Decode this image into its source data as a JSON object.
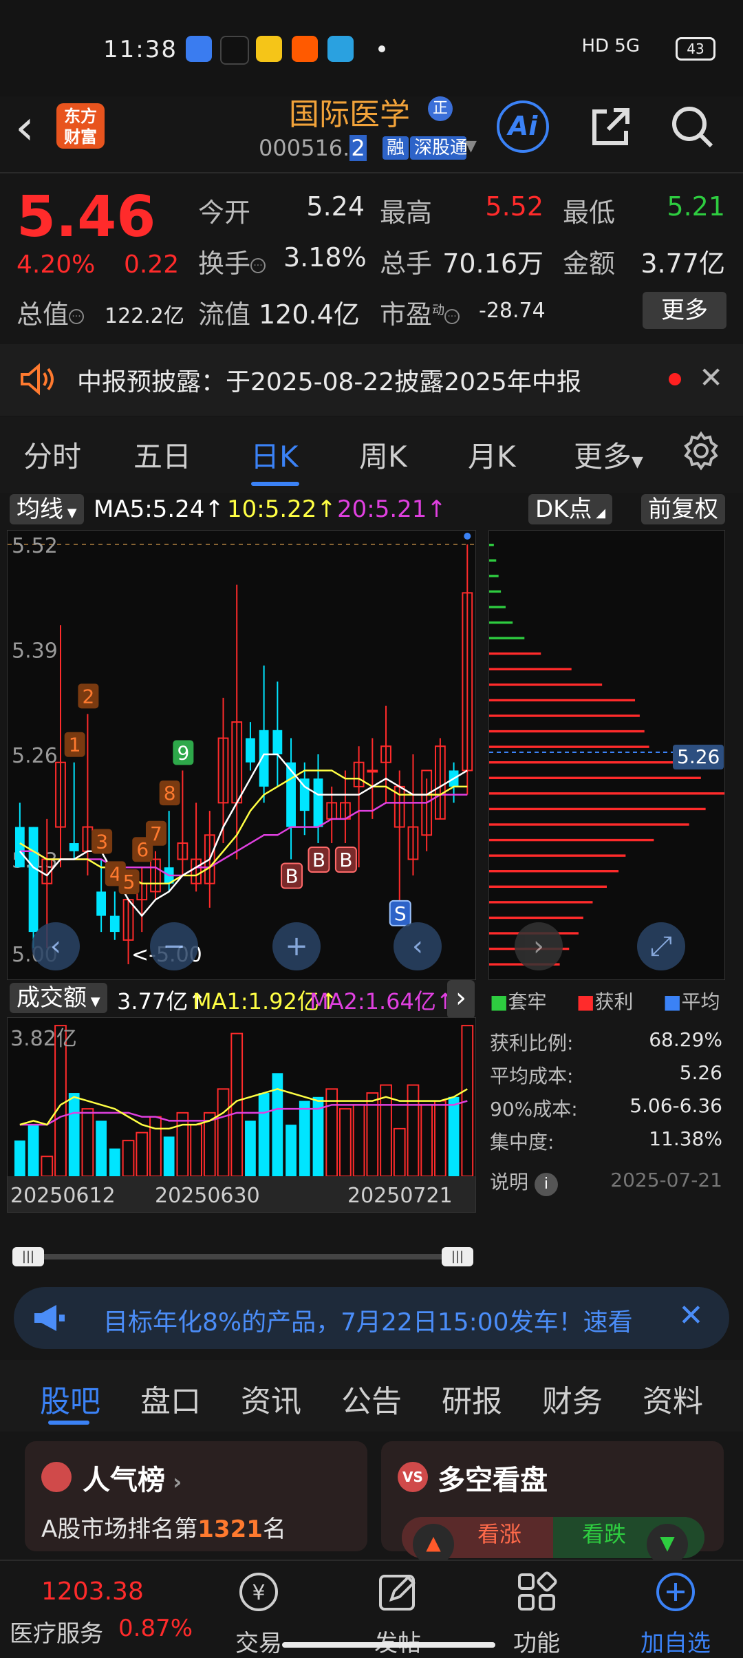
{
  "status_bar": {
    "time": "11:38",
    "network": "HD 5G",
    "battery": "43",
    "app_icons": [
      "app-icon-1",
      "tiktok-icon",
      "app-icon-3",
      "taobao-icon",
      "telegram-icon"
    ]
  },
  "header": {
    "stock_name": "国际医学",
    "name_badge": "正",
    "code": "000516.",
    "code_suffix": "2",
    "tags": [
      "融",
      "深股通"
    ],
    "logo_text_1": "东方",
    "logo_text_2": "财富",
    "ai_label": "Ai"
  },
  "quote": {
    "price": "5.46",
    "change_pct": "4.20%",
    "change": "0.22",
    "open_label": "今开",
    "open": "5.24",
    "high_label": "最高",
    "high": "5.52",
    "low_label": "最低",
    "low": "5.21",
    "turnover_label": "换手",
    "turnover": "3.18%",
    "volume_label": "总手",
    "volume": "70.16万",
    "amount_label": "金额",
    "amount": "3.77亿",
    "mktcap_label": "总值",
    "mktcap": "122.2亿",
    "float_label": "流值",
    "float": "120.4亿",
    "pe_label": "市盈",
    "pe_sup": "动",
    "pe": "-28.74",
    "more_label": "更多"
  },
  "notice": {
    "text": "中报预披露：于2025-08-22披露2025年中报"
  },
  "chart_tabs": [
    "分时",
    "五日",
    "日K",
    "周K",
    "月K",
    "更多"
  ],
  "chart_legend": {
    "ma_selector": "均线",
    "ma5": "MA5:5.24",
    "ma10": "10:5.22",
    "ma20": "20:5.21",
    "dk_label": "DK点",
    "adjust_label": "前复权",
    "arrow": "↑"
  },
  "colors": {
    "up": "#ff2b2b",
    "down": "#00e5ff",
    "ma5": "#ffffff",
    "ma10": "#ffff44",
    "ma20": "#e040e0",
    "accent": "#3b82f6",
    "green": "#2ecc40"
  },
  "chart_data": {
    "type": "candlestick",
    "y_ticks": [
      "5.52",
      "5.39",
      "5.26",
      "5.13",
      "5.00"
    ],
    "ylim": [
      5.0,
      5.52
    ],
    "high_marker": "5.52->",
    "low_marker": "<-5.00",
    "x_ticks": [
      "20250612",
      "20250630",
      "20250721"
    ],
    "candles": [
      {
        "o": 5.17,
        "h": 5.2,
        "l": 5.12,
        "c": 5.12
      },
      {
        "o": 5.17,
        "h": 5.17,
        "l": 5.02,
        "c": 5.04
      },
      {
        "o": 5.1,
        "h": 5.18,
        "l": 5.02,
        "c": 5.13
      },
      {
        "o": 5.17,
        "h": 5.42,
        "l": 5.12,
        "c": 5.25
      },
      {
        "o": 5.15,
        "h": 5.25,
        "l": 5.13,
        "c": 5.14
      },
      {
        "o": 5.14,
        "h": 5.31,
        "l": 5.11,
        "c": 5.17
      },
      {
        "o": 5.09,
        "h": 5.13,
        "l": 5.04,
        "c": 5.06
      },
      {
        "o": 5.06,
        "h": 5.09,
        "l": 5.03,
        "c": 5.04
      },
      {
        "o": 5.03,
        "h": 5.08,
        "l": 5.0,
        "c": 5.08
      },
      {
        "o": 5.08,
        "h": 5.12,
        "l": 5.04,
        "c": 5.1
      },
      {
        "o": 5.09,
        "h": 5.14,
        "l": 5.08,
        "c": 5.13
      },
      {
        "o": 5.12,
        "h": 5.19,
        "l": 5.09,
        "c": 5.1
      },
      {
        "o": 5.13,
        "h": 5.24,
        "l": 5.11,
        "c": 5.15
      },
      {
        "o": 5.1,
        "h": 5.2,
        "l": 5.09,
        "c": 5.13
      },
      {
        "o": 5.1,
        "h": 5.19,
        "l": 5.07,
        "c": 5.16
      },
      {
        "o": 5.2,
        "h": 5.33,
        "l": 5.15,
        "c": 5.28
      },
      {
        "o": 5.2,
        "h": 5.47,
        "l": 5.13,
        "c": 5.3
      },
      {
        "o": 5.28,
        "h": 5.3,
        "l": 5.24,
        "c": 5.25
      },
      {
        "o": 5.29,
        "h": 5.37,
        "l": 5.2,
        "c": 5.22
      },
      {
        "o": 5.29,
        "h": 5.35,
        "l": 5.22,
        "c": 5.26
      },
      {
        "o": 5.25,
        "h": 5.28,
        "l": 5.13,
        "c": 5.17
      },
      {
        "o": 5.23,
        "h": 5.25,
        "l": 5.16,
        "c": 5.19
      },
      {
        "o": 5.23,
        "h": 5.26,
        "l": 5.15,
        "c": 5.17
      },
      {
        "o": 5.18,
        "h": 5.22,
        "l": 5.15,
        "c": 5.2
      },
      {
        "o": 5.18,
        "h": 5.24,
        "l": 5.15,
        "c": 5.2
      },
      {
        "o": 5.22,
        "h": 5.27,
        "l": 5.12,
        "c": 5.25
      },
      {
        "o": 5.24,
        "h": 5.28,
        "l": 5.18,
        "c": 5.24
      },
      {
        "o": 5.25,
        "h": 5.32,
        "l": 5.2,
        "c": 5.27
      },
      {
        "o": 5.17,
        "h": 5.24,
        "l": 5.07,
        "c": 5.22
      },
      {
        "o": 5.13,
        "h": 5.26,
        "l": 5.11,
        "c": 5.17
      },
      {
        "o": 5.16,
        "h": 5.23,
        "l": 5.14,
        "c": 5.24
      },
      {
        "o": 5.18,
        "h": 5.28,
        "l": 5.18,
        "c": 5.27
      },
      {
        "o": 5.24,
        "h": 5.25,
        "l": 5.2,
        "c": 5.22
      },
      {
        "o": 5.24,
        "h": 5.52,
        "l": 5.21,
        "c": 5.46
      }
    ],
    "ma5": [
      5.14,
      5.12,
      5.11,
      5.13,
      5.13,
      5.14,
      5.14,
      5.11,
      5.08,
      5.06,
      5.08,
      5.09,
      5.11,
      5.12,
      5.13,
      5.17,
      5.2,
      5.23,
      5.26,
      5.26,
      5.24,
      5.22,
      5.21,
      5.21,
      5.21,
      5.21,
      5.22,
      5.23,
      5.22,
      5.21,
      5.21,
      5.22,
      5.23,
      5.24
    ],
    "ma10": [
      5.15,
      5.14,
      5.13,
      5.13,
      5.13,
      5.13,
      5.12,
      5.12,
      5.11,
      5.1,
      5.1,
      5.1,
      5.11,
      5.11,
      5.12,
      5.14,
      5.16,
      5.19,
      5.21,
      5.22,
      5.23,
      5.24,
      5.24,
      5.24,
      5.23,
      5.23,
      5.22,
      5.22,
      5.21,
      5.21,
      5.21,
      5.21,
      5.22,
      5.22
    ],
    "ma20": [
      5.14,
      5.14,
      5.13,
      5.13,
      5.13,
      5.13,
      5.13,
      5.12,
      5.12,
      5.12,
      5.12,
      5.11,
      5.11,
      5.12,
      5.12,
      5.13,
      5.14,
      5.15,
      5.16,
      5.16,
      5.17,
      5.17,
      5.17,
      5.18,
      5.18,
      5.19,
      5.19,
      5.2,
      5.2,
      5.2,
      5.2,
      5.21,
      5.21,
      5.21
    ],
    "markers": [
      {
        "i": 4,
        "label": "1",
        "type": "num"
      },
      {
        "i": 5,
        "label": "2",
        "type": "num"
      },
      {
        "i": 6,
        "label": "3",
        "type": "num"
      },
      {
        "i": 7,
        "label": "4",
        "type": "num"
      },
      {
        "i": 8,
        "label": "5",
        "type": "num"
      },
      {
        "i": 9,
        "label": "6",
        "type": "num"
      },
      {
        "i": 10,
        "label": "7",
        "type": "num"
      },
      {
        "i": 11,
        "label": "8",
        "type": "num"
      },
      {
        "i": 12,
        "label": "9",
        "type": "green"
      },
      {
        "i": 20,
        "label": "B",
        "type": "buy"
      },
      {
        "i": 22,
        "label": "B",
        "type": "buy"
      },
      {
        "i": 24,
        "label": "B",
        "type": "buy"
      },
      {
        "i": 28,
        "label": "S",
        "type": "sell"
      }
    ]
  },
  "volume": {
    "selector": "成交额",
    "value": "3.77亿",
    "ma1": "MA1:1.92亿",
    "ma2": "MA2:1.64亿",
    "max_label": "3.82亿",
    "values": [
      0.9,
      1.3,
      0.5,
      3.8,
      2.1,
      1.7,
      1.4,
      0.7,
      0.9,
      1.1,
      1.5,
      1.0,
      1.6,
      1.3,
      1.6,
      2.2,
      3.6,
      1.4,
      2.1,
      2.6,
      1.3,
      1.9,
      2.0,
      2.2,
      1.7,
      1.8,
      2.1,
      2.3,
      1.2,
      2.3,
      1.8,
      1.9,
      2.0,
      3.8
    ],
    "ma_1": [
      1.3,
      1.4,
      1.3,
      1.8,
      2.0,
      1.9,
      1.8,
      1.7,
      1.5,
      1.3,
      1.2,
      1.2,
      1.3,
      1.3,
      1.4,
      1.6,
      1.9,
      2.0,
      2.1,
      2.2,
      2.1,
      2.0,
      1.9,
      1.9,
      1.9,
      1.9,
      1.9,
      2.0,
      1.9,
      1.9,
      1.9,
      1.9,
      2.0,
      2.2
    ],
    "ma_2": [
      1.3,
      1.3,
      1.3,
      1.5,
      1.6,
      1.6,
      1.6,
      1.6,
      1.6,
      1.5,
      1.5,
      1.4,
      1.4,
      1.4,
      1.4,
      1.5,
      1.6,
      1.6,
      1.6,
      1.7,
      1.7,
      1.7,
      1.7,
      1.8,
      1.8,
      1.8,
      1.8,
      1.8,
      1.8,
      1.8,
      1.8,
      1.8,
      1.8,
      1.9
    ]
  },
  "chip_dist": {
    "avg_price_label": "5.26",
    "bars": [
      0.02,
      0.03,
      0.04,
      0.05,
      0.07,
      0.1,
      0.15,
      0.22,
      0.35,
      0.48,
      0.62,
      0.64,
      0.66,
      0.68,
      0.8,
      0.9,
      1.0,
      0.92,
      0.85,
      0.7,
      0.58,
      0.55,
      0.5,
      0.44,
      0.4,
      0.38,
      0.34,
      0.3
    ],
    "legend": [
      "套牢",
      "获利",
      "平均"
    ],
    "profit_ratio_label": "获利比例:",
    "profit_ratio": "68.29%",
    "avg_cost_label": "平均成本:",
    "avg_cost": "5.26",
    "cost90_label": "90%成本:",
    "cost90": "5.06-6.36",
    "concentration_label": "集中度:",
    "concentration": "11.38%",
    "note_label": "说明",
    "date": "2025-07-21"
  },
  "ad": {
    "text": "目标年化8%的产品，7月22日15:00发车！速看"
  },
  "lower_tabs": [
    "股吧",
    "盘口",
    "资讯",
    "公告",
    "研报",
    "财务",
    "资料"
  ],
  "cards": {
    "popularity_title": "人气榜",
    "popularity_text_prefix": "A股市场排名第",
    "popularity_rank": "1321",
    "popularity_text_suffix": "名",
    "vs_title": "多空看盘",
    "bull_label": "看涨",
    "bear_label": "看跌",
    "vs_badge": "VS"
  },
  "bottom_nav": {
    "index_value": "1203.38",
    "index_name": "医疗服务",
    "index_pct": "0.87%",
    "items": [
      "交易",
      "发帖",
      "功能",
      "加自选"
    ]
  }
}
